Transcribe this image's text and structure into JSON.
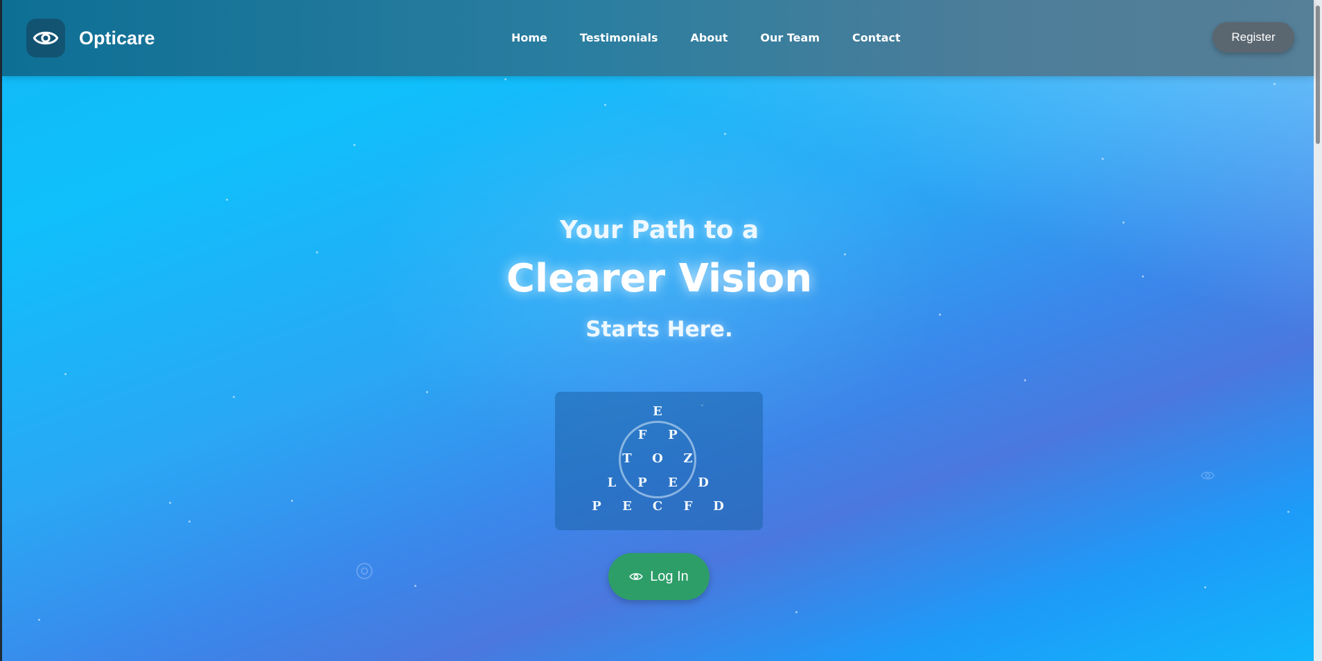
{
  "brand": {
    "name": "Opticare",
    "icon": "eye-icon"
  },
  "nav": {
    "links": [
      "Home",
      "Testimonials",
      "About",
      "Our Team",
      "Contact"
    ],
    "register_label": "Register"
  },
  "hero": {
    "line1": "Your Path to a",
    "line2": "Clearer Vision",
    "line3": "Starts Here."
  },
  "eye_chart": {
    "rows": [
      [
        "E"
      ],
      [
        "F",
        "P"
      ],
      [
        "T",
        "O",
        "Z"
      ],
      [
        "L",
        "P",
        "E",
        "D"
      ],
      [
        "P",
        "E",
        "C",
        "F",
        "D"
      ]
    ]
  },
  "login": {
    "label": "Log In",
    "icon": "eye-icon"
  },
  "colors": {
    "navbar": "#0e6f95",
    "login_button": "#2e9e69",
    "register_button": "#5b6770",
    "background": "#1d9bf8"
  }
}
